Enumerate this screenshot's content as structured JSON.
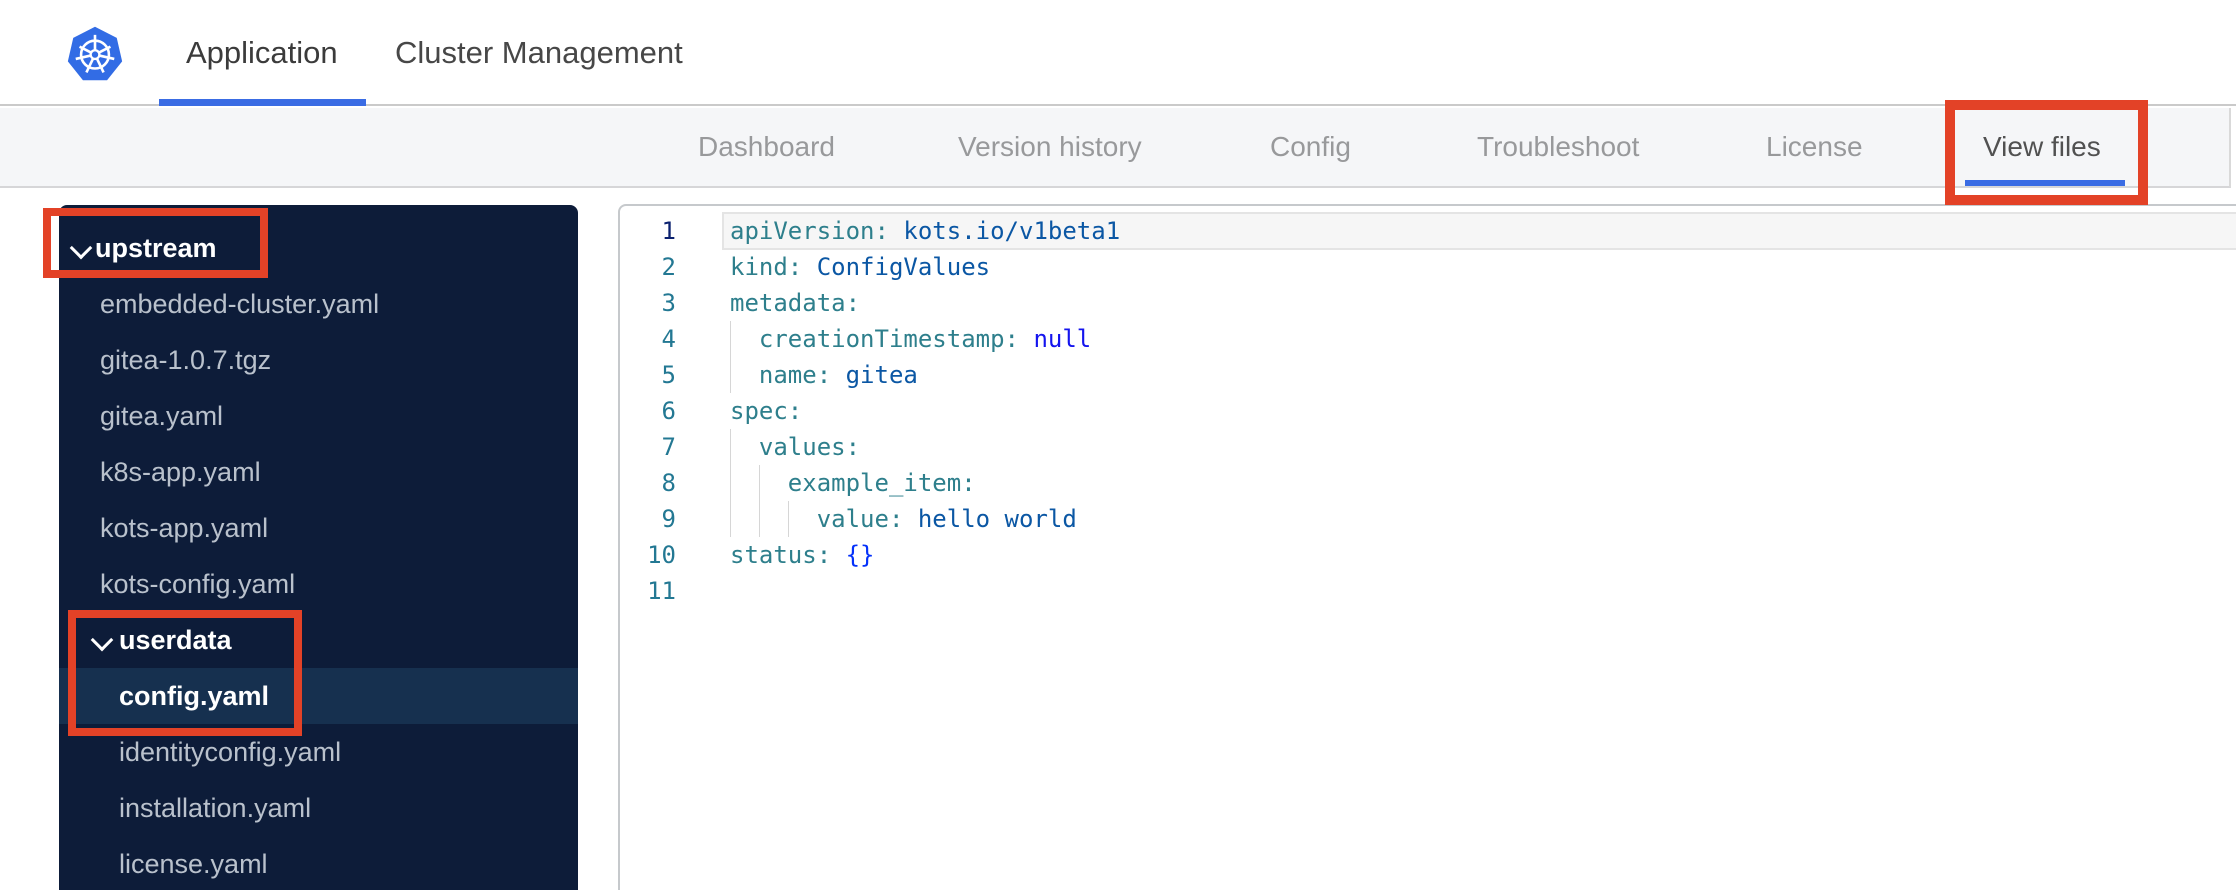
{
  "header": {
    "tabs": [
      {
        "label": "Application",
        "active": true
      },
      {
        "label": "Cluster Management",
        "active": false
      }
    ]
  },
  "subnav": {
    "tabs": [
      {
        "label": "Dashboard",
        "active": false
      },
      {
        "label": "Version history",
        "active": false
      },
      {
        "label": "Config",
        "active": false
      },
      {
        "label": "Troubleshoot",
        "active": false
      },
      {
        "label": "License",
        "active": false
      },
      {
        "label": "View files",
        "active": true
      }
    ]
  },
  "tree": {
    "items": [
      {
        "label": "upstream",
        "type": "folder",
        "expanded": true
      },
      {
        "label": "embedded-cluster.yaml",
        "type": "file"
      },
      {
        "label": "gitea-1.0.7.tgz",
        "type": "file"
      },
      {
        "label": "gitea.yaml",
        "type": "file"
      },
      {
        "label": "k8s-app.yaml",
        "type": "file"
      },
      {
        "label": "kots-app.yaml",
        "type": "file"
      },
      {
        "label": "kots-config.yaml",
        "type": "file"
      },
      {
        "label": "userdata",
        "type": "folder",
        "expanded": true
      },
      {
        "label": "config.yaml",
        "type": "file",
        "selected": true
      },
      {
        "label": "identityconfig.yaml",
        "type": "file"
      },
      {
        "label": "installation.yaml",
        "type": "file"
      },
      {
        "label": "license.yaml",
        "type": "file"
      }
    ]
  },
  "editor": {
    "lines": [
      {
        "num": "1",
        "active": true,
        "segs": [
          [
            "c-key",
            "apiVersion:"
          ],
          [
            "c-pln",
            " "
          ],
          [
            "c-str",
            "kots.io/v1beta1"
          ]
        ]
      },
      {
        "num": "2",
        "segs": [
          [
            "c-key",
            "kind:"
          ],
          [
            "c-pln",
            " "
          ],
          [
            "c-str",
            "ConfigValues"
          ]
        ]
      },
      {
        "num": "3",
        "segs": [
          [
            "c-key",
            "metadata:"
          ]
        ]
      },
      {
        "num": "4",
        "segs": [
          [
            "c-pln",
            "  "
          ],
          [
            "c-key",
            "creationTimestamp:"
          ],
          [
            "c-pln",
            " "
          ],
          [
            "c-kw",
            "null"
          ]
        ]
      },
      {
        "num": "5",
        "segs": [
          [
            "c-pln",
            "  "
          ],
          [
            "c-key",
            "name:"
          ],
          [
            "c-pln",
            " "
          ],
          [
            "c-str",
            "gitea"
          ]
        ]
      },
      {
        "num": "6",
        "segs": [
          [
            "c-key",
            "spec:"
          ]
        ]
      },
      {
        "num": "7",
        "segs": [
          [
            "c-pln",
            "  "
          ],
          [
            "c-key",
            "values:"
          ]
        ]
      },
      {
        "num": "8",
        "segs": [
          [
            "c-pln",
            "    "
          ],
          [
            "c-key",
            "example_item:"
          ]
        ]
      },
      {
        "num": "9",
        "segs": [
          [
            "c-pln",
            "      "
          ],
          [
            "c-key",
            "value:"
          ],
          [
            "c-pln",
            " "
          ],
          [
            "c-str",
            "hello world"
          ]
        ]
      },
      {
        "num": "10",
        "segs": [
          [
            "c-key",
            "status:"
          ],
          [
            "c-pln",
            " "
          ],
          [
            "c-brc",
            "{}"
          ]
        ]
      },
      {
        "num": "11",
        "segs": []
      }
    ]
  },
  "annotations": [
    {
      "target": "view-files-tab"
    },
    {
      "target": "upstream-folder"
    },
    {
      "target": "userdata-config-yaml"
    }
  ],
  "colors": {
    "accent_blue": "#3a6ce4",
    "logo_blue": "#326ce5",
    "annotation_red": "#e34227",
    "sidebar_bg": "#0d1c39",
    "sidebar_selected_bg": "#16304f",
    "subnav_bg": "#f5f6f8",
    "yaml_key": "#2e7f8c",
    "yaml_string": "#0b57a4",
    "yaml_keyword": "#1414ee",
    "line_number": "#237893"
  }
}
